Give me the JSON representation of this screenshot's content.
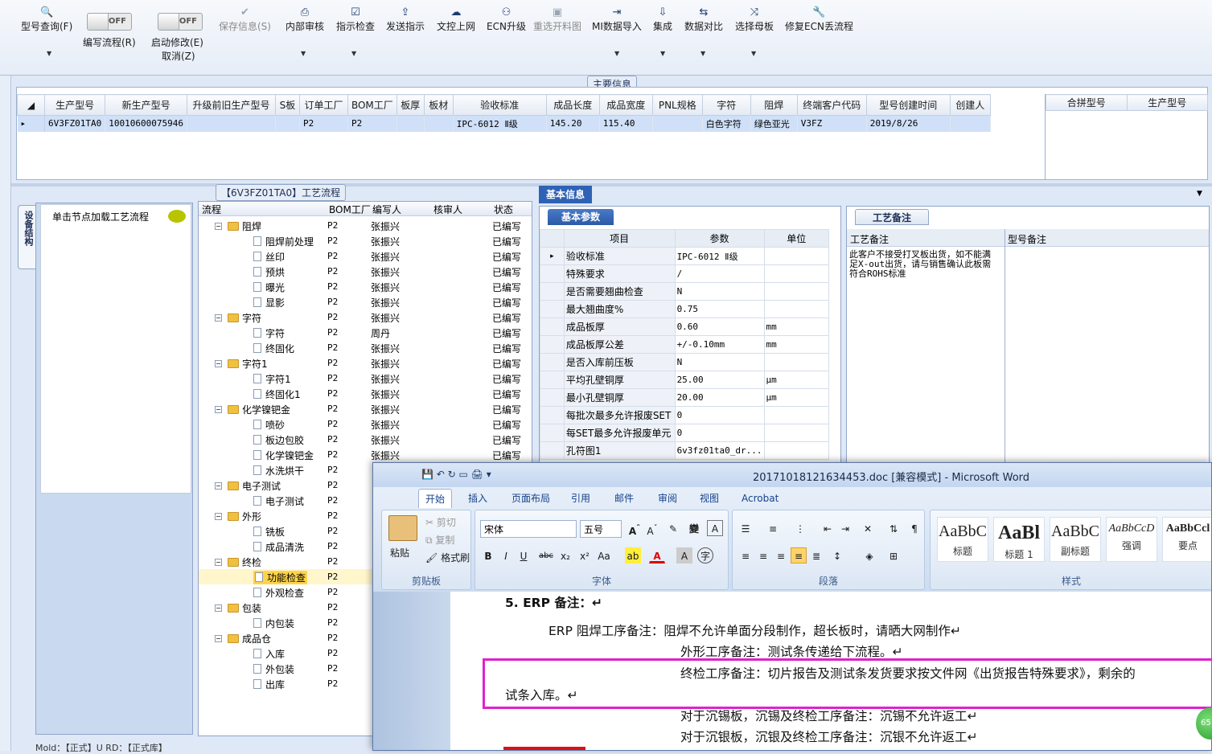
{
  "toolbar": {
    "buttons": [
      {
        "label": "型号查询(F)",
        "icon": "magnifier-icon"
      },
      {
        "label": "编写流程(R)",
        "toggle": "OFF"
      },
      {
        "label": "启动修改(E)",
        "sub": "取消(Z)",
        "toggle": "OFF"
      },
      {
        "label": "保存信息(S)",
        "icon": "check-icon",
        "disabled": true
      },
      {
        "label": "内部审核",
        "icon": "printer-icon"
      },
      {
        "label": "指示检查",
        "icon": "checkbox-icon"
      },
      {
        "label": "发送指示",
        "icon": "upload-icon"
      },
      {
        "label": "文控上网",
        "icon": "cloud-icon"
      },
      {
        "label": "ECN升级",
        "icon": "binoculars-icon"
      },
      {
        "label": "重选开料图",
        "icon": "image-icon",
        "disabled": true
      },
      {
        "label": "MI数据导入",
        "icon": "import-icon"
      },
      {
        "label": "集成",
        "icon": "download-icon"
      },
      {
        "label": "数据对比",
        "icon": "compare-icon"
      },
      {
        "label": "选择母板",
        "icon": "shuffle-icon"
      },
      {
        "label": "修复ECN丢流程",
        "icon": "wrench-icon"
      }
    ]
  },
  "main_info": {
    "title": "主要信息",
    "columns": [
      "生产型号",
      "新生产型号",
      "升级前旧生产型号",
      "S板",
      "订单工厂",
      "BOM工厂",
      "板厚",
      "板材",
      "验收标准",
      "成品长度",
      "成品宽度",
      "PNL规格",
      "字符",
      "阻焊",
      "终端客户代码",
      "型号创建时间",
      "创建人"
    ],
    "row": [
      "6V3FZ01TA0",
      "10010600075946",
      "",
      "",
      "P2",
      "P2",
      "",
      "",
      "IPC-6012 Ⅱ级",
      "145.20",
      "115.40",
      "",
      "白色字符",
      "绿色亚光",
      "V3FZ",
      "2019/8/26",
      ""
    ],
    "side_columns": [
      "合拼型号",
      "生产型号"
    ]
  },
  "process": {
    "title": "【6V3FZ01TA0】工艺流程",
    "side_tab": "设备结构",
    "side_hint": "单击节点加载工艺流程",
    "columns": [
      "流程",
      "BOM工厂",
      "编写人",
      "核审人",
      "状态"
    ],
    "rows": [
      {
        "name": "阻焊",
        "level": 0,
        "bom": "P2",
        "author": "张振兴",
        "status": "已编写"
      },
      {
        "name": "阻焊前处理",
        "level": 1,
        "bom": "P2",
        "author": "张振兴",
        "status": "已编写"
      },
      {
        "name": "丝印",
        "level": 1,
        "bom": "P2",
        "author": "张振兴",
        "status": "已编写"
      },
      {
        "name": "预烘",
        "level": 1,
        "bom": "P2",
        "author": "张振兴",
        "status": "已编写"
      },
      {
        "name": "曝光",
        "level": 1,
        "bom": "P2",
        "author": "张振兴",
        "status": "已编写"
      },
      {
        "name": "显影",
        "level": 1,
        "bom": "P2",
        "author": "张振兴",
        "status": "已编写"
      },
      {
        "name": "字符",
        "level": 0,
        "bom": "P2",
        "author": "张振兴",
        "status": "已编写"
      },
      {
        "name": "字符",
        "level": 1,
        "bom": "P2",
        "author": "周丹",
        "status": "已编写"
      },
      {
        "name": "终固化",
        "level": 1,
        "bom": "P2",
        "author": "张振兴",
        "status": "已编写"
      },
      {
        "name": "字符1",
        "level": 0,
        "bom": "P2",
        "author": "张振兴",
        "status": "已编写"
      },
      {
        "name": "字符1",
        "level": 1,
        "bom": "P2",
        "author": "张振兴",
        "status": "已编写"
      },
      {
        "name": "终固化1",
        "level": 1,
        "bom": "P2",
        "author": "张振兴",
        "status": "已编写"
      },
      {
        "name": "化学镍钯金",
        "level": 0,
        "bom": "P2",
        "author": "张振兴",
        "status": "已编写"
      },
      {
        "name": "喷砂",
        "level": 1,
        "bom": "P2",
        "author": "张振兴",
        "status": "已编写"
      },
      {
        "name": "板边包胶",
        "level": 1,
        "bom": "P2",
        "author": "张振兴",
        "status": "已编写"
      },
      {
        "name": "化学镍钯金",
        "level": 1,
        "bom": "P2",
        "author": "张振兴",
        "status": "已编写"
      },
      {
        "name": "水洗烘干",
        "level": 1,
        "bom": "P2",
        "author": "",
        "status": ""
      },
      {
        "name": "电子测试",
        "level": 0,
        "bom": "P2",
        "author": "",
        "status": ""
      },
      {
        "name": "电子测试",
        "level": 1,
        "bom": "P2",
        "author": "",
        "status": ""
      },
      {
        "name": "外形",
        "level": 0,
        "bom": "P2",
        "author": "",
        "status": ""
      },
      {
        "name": "铣板",
        "level": 1,
        "bom": "P2",
        "author": "",
        "status": ""
      },
      {
        "name": "成品清洗",
        "level": 1,
        "bom": "P2",
        "author": "",
        "status": ""
      },
      {
        "name": "终检",
        "level": 0,
        "bom": "P2",
        "author": "",
        "status": ""
      },
      {
        "name": "功能检查",
        "level": 1,
        "bom": "P2",
        "author": "",
        "status": "",
        "selected": true
      },
      {
        "name": "外观检查",
        "level": 1,
        "bom": "P2",
        "author": "",
        "status": ""
      },
      {
        "name": "包装",
        "level": 0,
        "bom": "P2",
        "author": "",
        "status": ""
      },
      {
        "name": "内包装",
        "level": 1,
        "bom": "P2",
        "author": "",
        "status": ""
      },
      {
        "name": "成品仓",
        "level": 0,
        "bom": "P2",
        "author": "",
        "status": ""
      },
      {
        "name": "入库",
        "level": 1,
        "bom": "P2",
        "author": "",
        "status": ""
      },
      {
        "name": "外包装",
        "level": 1,
        "bom": "P2",
        "author": "",
        "status": ""
      },
      {
        "name": "出库",
        "level": 1,
        "bom": "P2",
        "author": "",
        "status": ""
      }
    ]
  },
  "basic": {
    "tab": "基本信息",
    "params_tab": "基本参数",
    "notes_tab": "工艺备注",
    "columns": [
      "项目",
      "参数",
      "单位"
    ],
    "rows": [
      [
        "验收标准",
        "IPC-6012 Ⅱ级",
        ""
      ],
      [
        "特殊要求",
        "/",
        ""
      ],
      [
        "是否需要翘曲检查",
        "N",
        ""
      ],
      [
        "最大翘曲度%",
        "0.75",
        ""
      ],
      [
        "成品板厚",
        "0.60",
        "mm"
      ],
      [
        "成品板厚公差",
        "+/-0.10mm",
        "mm"
      ],
      [
        "是否入库前压板",
        "N",
        ""
      ],
      [
        "平均孔壁铜厚",
        "25.00",
        "μm"
      ],
      [
        "最小孔壁铜厚",
        "20.00",
        "μm"
      ],
      [
        "每批次最多允许报废SET",
        "0",
        ""
      ],
      [
        "每SET最多允许报废单元",
        "0",
        ""
      ],
      [
        "孔符图1",
        "6v3fz01ta0_dr...",
        ""
      ]
    ],
    "notes_columns": [
      "工艺备注",
      "型号备注"
    ],
    "note_text": "此客户不接受打叉板出货，如不能满足X-out出货，请与销售确认此板需符合ROHS标准"
  },
  "word": {
    "title": "20171018121634453.doc [兼容模式] - Microsoft Word",
    "tabs": [
      "开始",
      "插入",
      "页面布局",
      "引用",
      "邮件",
      "审阅",
      "视图",
      "Acrobat"
    ],
    "clipboard": {
      "paste": "粘贴",
      "cut": "剪切",
      "copy": "复制",
      "format": "格式刷",
      "label": "剪贴板"
    },
    "font": {
      "name": "宋体",
      "size": "五号",
      "label": "字体"
    },
    "paragraph_label": "段落",
    "styles_label": "样式",
    "styles": [
      {
        "preview": "AaBbC",
        "name": "标题"
      },
      {
        "preview": "AaBl",
        "name": "标题 1"
      },
      {
        "preview": "AaBbC",
        "name": "副标题"
      },
      {
        "preview": "AaBbCcD",
        "name": "强调"
      },
      {
        "preview": "AaBbCcl",
        "name": "要点"
      }
    ],
    "lines": [
      "5.  ERP 备注：↵",
      "ERP 阻焊工序备注：阻焊不允许单面分段制作，超长板时，请晒大网制作↵",
      "外形工序备注：测试条传递给下流程。↵",
      "终检工序备注：切片报告及测试条发货要求按文件网《出货报告特殊要求》，剩余的",
      "试条入库。↵",
      "对于沉锡板，沉锡及终检工序备注：沉锡不允许返工↵",
      "对于沉银板，沉银及终检工序备注：沉银不允许返工↵"
    ]
  },
  "status": "Mold：【正式】U RD：【正式库】",
  "badge": "65"
}
